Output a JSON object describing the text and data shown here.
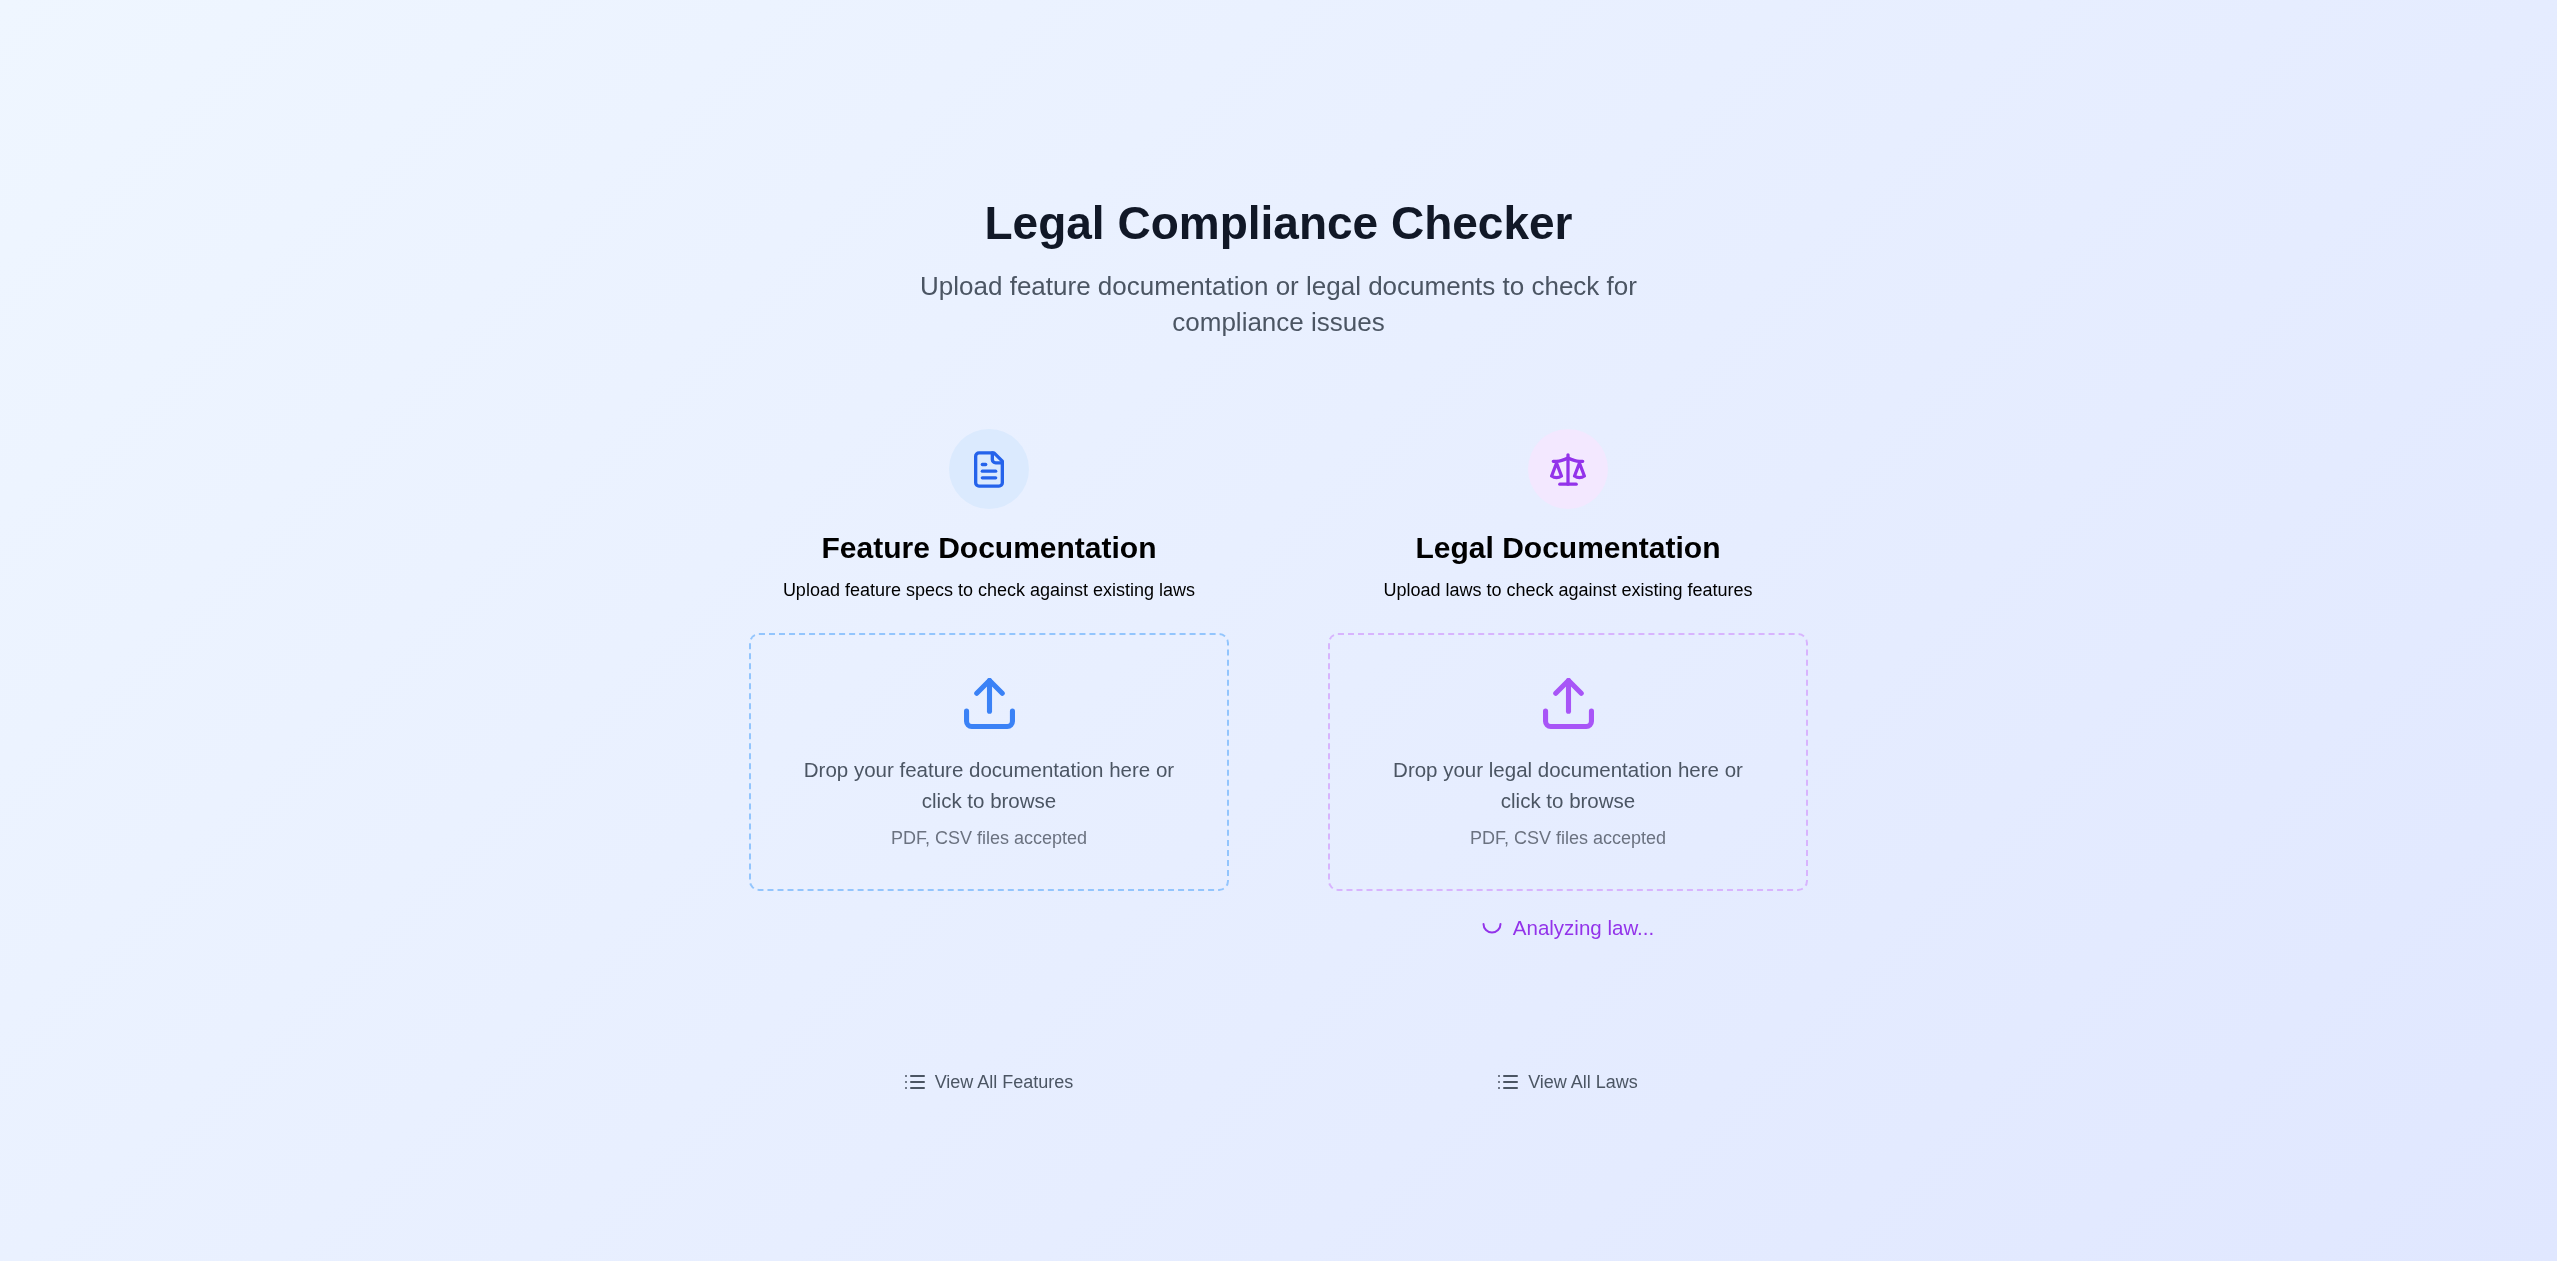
{
  "header": {
    "title": "Legal Compliance Checker",
    "subtitle": "Upload feature documentation or legal documents to check for compliance issues"
  },
  "upload_panels": [
    {
      "kind": "feature",
      "title": "Feature Documentation",
      "description": "Upload feature specs to check against existing laws",
      "drop_text": "Drop your feature documentation here or click to browse",
      "accepted_formats": "PDF, CSV files accepted"
    },
    {
      "kind": "legal",
      "title": "Legal Documentation",
      "description": "Upload laws to check against existing features",
      "drop_text": "Drop your legal documentation here or click to browse",
      "accepted_formats": "PDF, CSV files accepted",
      "status": {
        "loading": true,
        "text": "Analyzing law..."
      }
    }
  ],
  "links": [
    {
      "label": "View All Features"
    },
    {
      "label": "View All Laws"
    }
  ]
}
